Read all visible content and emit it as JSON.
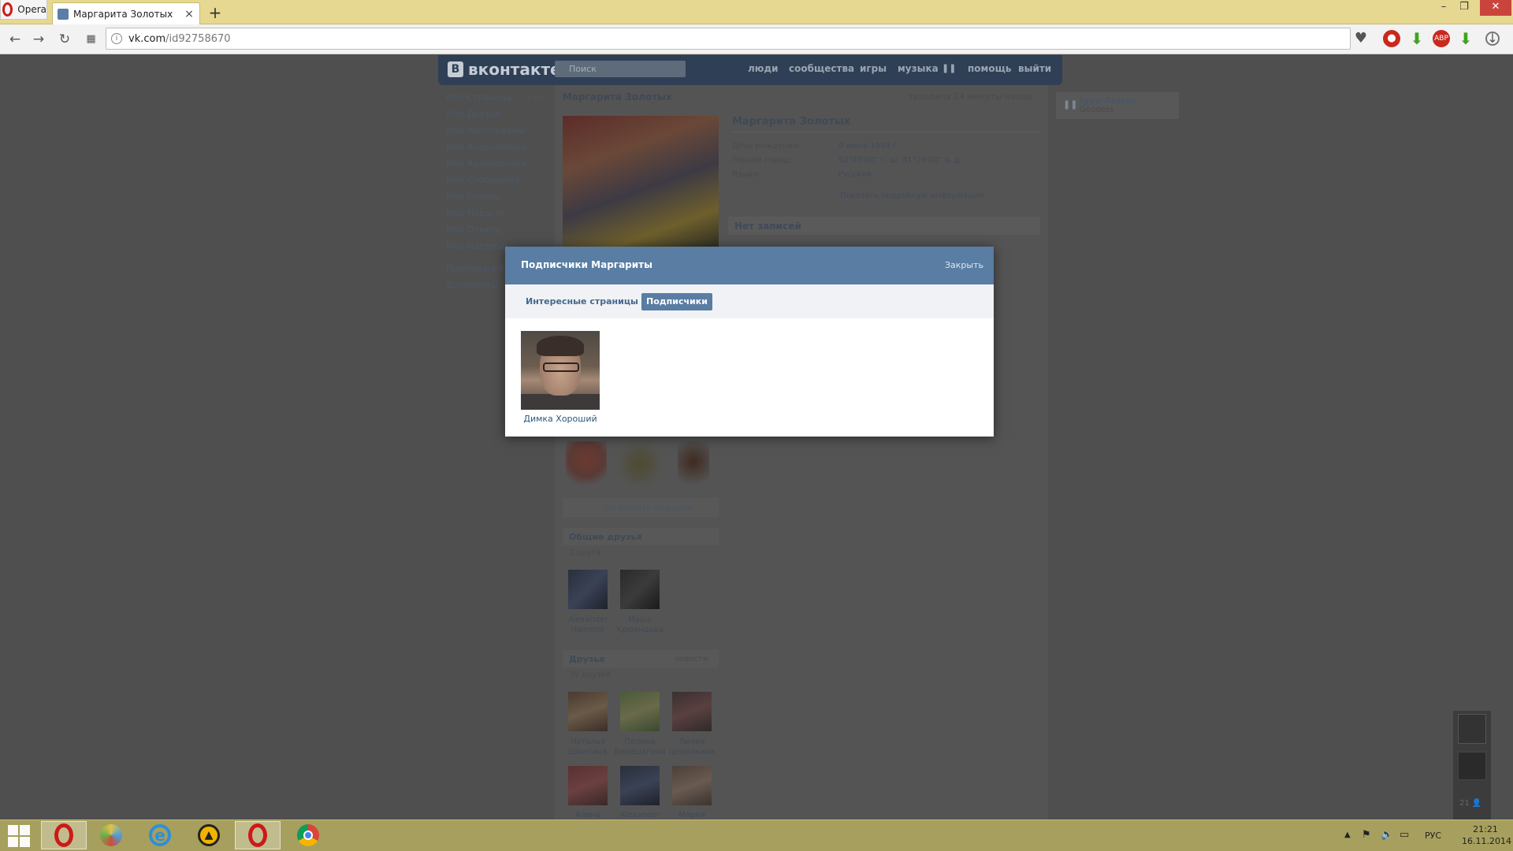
{
  "browser": {
    "menu_label": "Opera",
    "tab_title": "Маргарита Золотых",
    "new_tab": "+",
    "url_host": "vk.com",
    "url_path": "/id92758670",
    "icons": [
      "back-icon",
      "forward-icon",
      "reload-icon",
      "speed-dial-icon",
      "heart-icon",
      "record-icon",
      "download-icon",
      "adblock-icon",
      "download-icon",
      "menu-icon"
    ]
  },
  "vk": {
    "logo": "вконтакте",
    "logo_badge": "В",
    "search_placeholder": "Поиск",
    "nav": {
      "people": "люди",
      "communities": "сообщества",
      "games": "игры",
      "music": "музыка",
      "help": "помощь",
      "logout": "выйти"
    },
    "sidebar": {
      "edit": "ред.",
      "items": [
        "Моя Страница",
        "Мои Друзья",
        "Мои Фотографии",
        "Мои Видеозаписи",
        "Мои Аудиозаписи",
        "Мои Сообщения",
        "Мои Группы",
        "Мои Новости",
        "Мои Ответы",
        "Мои Настройки",
        "Приложения",
        "Документы"
      ]
    },
    "profile": {
      "header_name": "Маргарита Золотых",
      "last_seen": "заходила 24 минуты назад",
      "name": "Маргарита Золотых",
      "info": [
        {
          "label": "День рождения:",
          "value": "9 июня 1994 г."
        },
        {
          "label": "Родной город:",
          "value": "52°43'00\" с. ш. 41°26'00\" в. д."
        },
        {
          "label": "Языки:",
          "value": "Русский"
        }
      ],
      "show_more": "Показать подробную информацию",
      "no_posts": "Нет записей",
      "send_gift": "Отправить подарок"
    },
    "common_friends": {
      "title": "Общие друзья",
      "count": "2 друга",
      "people": [
        {
          "first": "Alexander",
          "last": "Hamster"
        },
        {
          "first": "Маша",
          "last": "Крюенцова"
        }
      ]
    },
    "friends": {
      "title": "Друзья",
      "link": "новости",
      "count": "39 друзей",
      "people": [
        {
          "first": "Наталья",
          "last": "Шкитина"
        },
        {
          "first": "Полина",
          "last": "Верещагина"
        },
        {
          "first": "Лилия",
          "last": "Цепалкина"
        },
        {
          "first": "Алена",
          "last": ""
        },
        {
          "first": "Alexander",
          "last": ""
        },
        {
          "first": "Мария",
          "last": ""
        }
      ]
    },
    "now_playing": {
      "artist": "Iggy Azalea",
      "title": "Goddess"
    },
    "chat_count": "21"
  },
  "modal": {
    "title": "Подписчики Маргариты",
    "close": "Закрыть",
    "tabs": [
      "Интересные страницы",
      "Подписчики"
    ],
    "active_tab": "Подписчики",
    "followers": [
      {
        "name": "Димка Хороший"
      }
    ]
  },
  "taskbar": {
    "apps": [
      "opera-icon",
      "paint-icon",
      "internet-explorer-icon",
      "aimp-icon",
      "opera-icon",
      "chrome-icon"
    ],
    "lang": "РУС",
    "time": "21:21",
    "date": "16.11.2014"
  },
  "colors": {
    "vk_blue": "#597da3",
    "tabbar": "#e6d891",
    "taskbar": "#a79f5d"
  }
}
